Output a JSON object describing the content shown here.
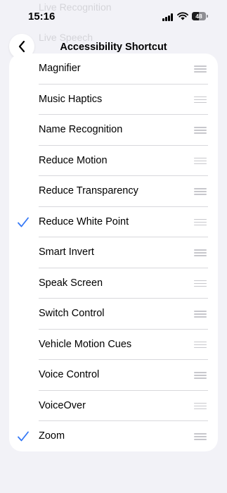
{
  "status_bar": {
    "time": "15:16",
    "battery": "48"
  },
  "background_items": [
    "Live Recognition",
    "Live Speech"
  ],
  "nav": {
    "title": "Accessibility Shortcut",
    "back_icon": "chevron-left-icon"
  },
  "items": [
    {
      "label": "Magnifier",
      "checked": false
    },
    {
      "label": "Music Haptics",
      "checked": false
    },
    {
      "label": "Name Recognition",
      "checked": false
    },
    {
      "label": "Reduce Motion",
      "checked": false
    },
    {
      "label": "Reduce Transparency",
      "checked": false
    },
    {
      "label": "Reduce White Point",
      "checked": true
    },
    {
      "label": "Smart Invert",
      "checked": false
    },
    {
      "label": "Speak Screen",
      "checked": false
    },
    {
      "label": "Switch Control",
      "checked": false
    },
    {
      "label": "Vehicle Motion Cues",
      "checked": false
    },
    {
      "label": "Voice Control",
      "checked": false
    },
    {
      "label": "VoiceOver",
      "checked": false
    },
    {
      "label": "Zoom",
      "checked": true
    }
  ],
  "colors": {
    "accent": "#3478f6",
    "background": "#f2f2f7",
    "handle": "#c7c7cc"
  }
}
